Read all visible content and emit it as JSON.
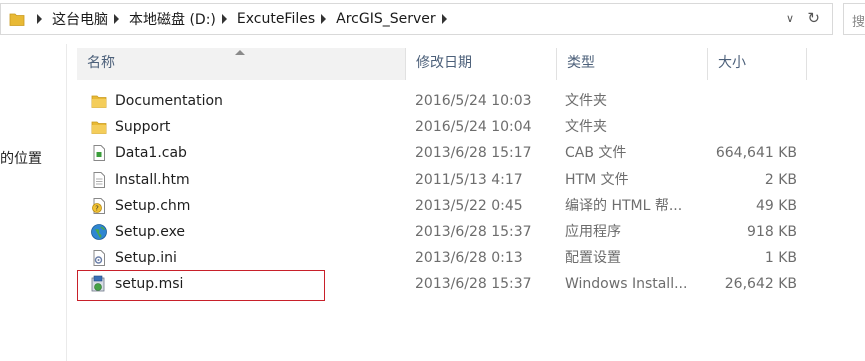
{
  "address_bar": {
    "crumbs": [
      "这台电脑",
      "本地磁盘 (D:)",
      "ExcuteFiles",
      "ArcGIS_Server"
    ]
  },
  "search": {
    "placeholder": "搜"
  },
  "nav_pane": {
    "partial_item": "的位置"
  },
  "columns": {
    "name": "名称",
    "date": "修改日期",
    "type": "类型",
    "size": "大小"
  },
  "files": [
    {
      "icon": "folder-icon",
      "name": "Documentation",
      "date": "2016/5/24 10:03",
      "type": "文件夹",
      "size": ""
    },
    {
      "icon": "folder-icon",
      "name": "Support",
      "date": "2016/5/24 10:04",
      "type": "文件夹",
      "size": ""
    },
    {
      "icon": "cab-file-icon",
      "name": "Data1.cab",
      "date": "2013/6/28 15:17",
      "type": "CAB 文件",
      "size": "664,641 KB"
    },
    {
      "icon": "html-file-icon",
      "name": "Install.htm",
      "date": "2011/5/13 4:17",
      "type": "HTM 文件",
      "size": "2 KB"
    },
    {
      "icon": "help-file-icon",
      "name": "Setup.chm",
      "date": "2013/5/22 0:45",
      "type": "编译的 HTML 帮...",
      "size": "49 KB"
    },
    {
      "icon": "exe-globe-icon",
      "name": "Setup.exe",
      "date": "2013/6/28 15:37",
      "type": "应用程序",
      "size": "918 KB"
    },
    {
      "icon": "ini-file-icon",
      "name": "Setup.ini",
      "date": "2013/6/28 0:13",
      "type": "配置设置",
      "size": "1 KB"
    },
    {
      "icon": "msi-installer-icon",
      "name": "setup.msi",
      "date": "2013/6/28 15:37",
      "type": "Windows Install...",
      "size": "26,642 KB"
    }
  ],
  "highlighted_file": "setup.msi",
  "colors": {
    "highlight_border": "#c8202a",
    "folder": "#e8b935",
    "header_text": "#4c607a"
  }
}
